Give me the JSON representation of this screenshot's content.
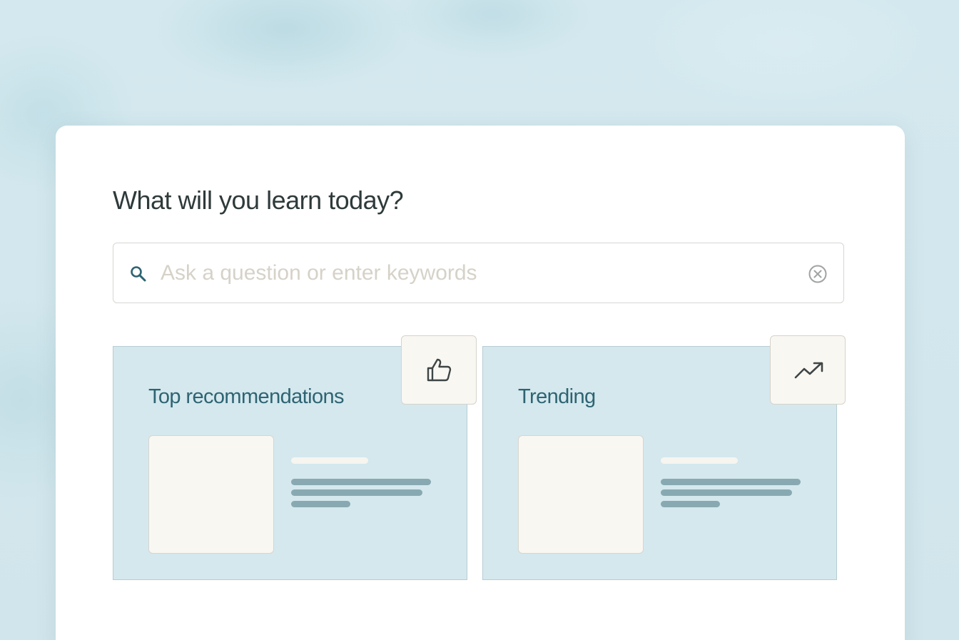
{
  "main": {
    "heading": "What will you learn today?"
  },
  "search": {
    "placeholder": "Ask a question or enter keywords",
    "value": "",
    "icon": "search-icon",
    "clear_icon": "clear-circle-x-icon"
  },
  "panels": [
    {
      "title": "Top recommendations",
      "badge_icon": "thumbs-up-icon"
    },
    {
      "title": "Trending",
      "badge_icon": "trending-up-icon"
    }
  ],
  "colors": {
    "background": "#d3e8ee",
    "panel": "#d4e8ee",
    "panel_title": "#2e6472",
    "placeholder_bar": "#88a9b1",
    "heading": "#2f3a3a"
  }
}
